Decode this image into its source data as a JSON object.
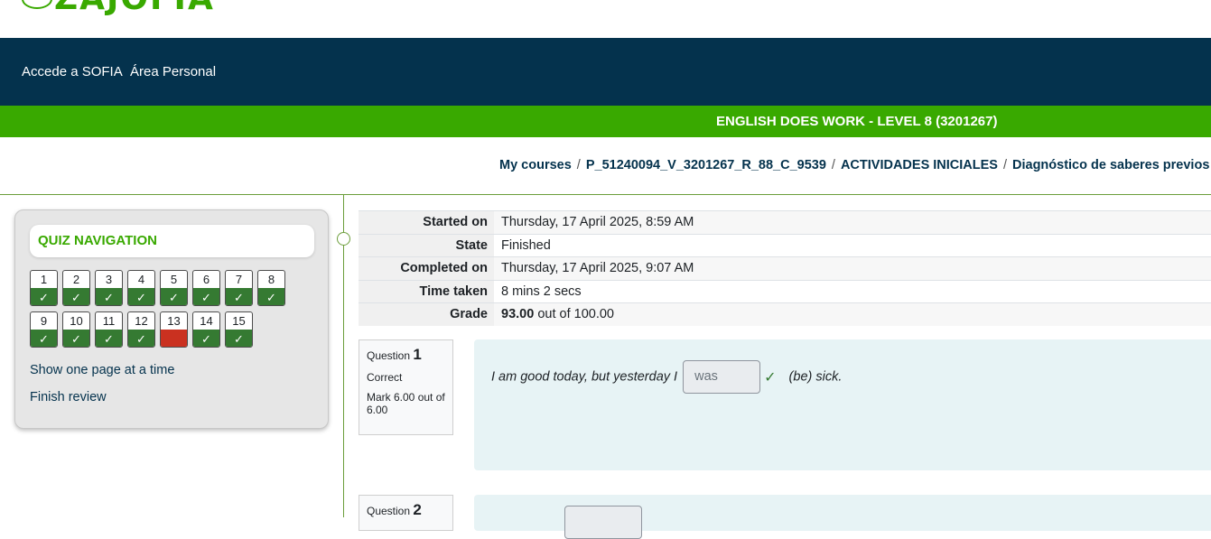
{
  "logo": {
    "text": "ZAJOFIA"
  },
  "navbar": {
    "items": [
      "Accede a SOFIA",
      "Área Personal"
    ]
  },
  "course": {
    "title": "ENGLISH DOES WORK - LEVEL 8 (3201267)"
  },
  "breadcrumb": [
    "My courses",
    "P_51240094_V_3201267_R_88_C_9539",
    "ACTIVIDADES INICIALES",
    "Diagnóstico de saberes previos"
  ],
  "quiz_nav": {
    "title": "QUIZ NAVIGATION",
    "questions": [
      {
        "n": "1",
        "status": "correct"
      },
      {
        "n": "2",
        "status": "correct"
      },
      {
        "n": "3",
        "status": "correct"
      },
      {
        "n": "4",
        "status": "correct"
      },
      {
        "n": "5",
        "status": "correct"
      },
      {
        "n": "6",
        "status": "correct"
      },
      {
        "n": "7",
        "status": "correct"
      },
      {
        "n": "8",
        "status": "correct"
      },
      {
        "n": "9",
        "status": "correct"
      },
      {
        "n": "10",
        "status": "correct"
      },
      {
        "n": "11",
        "status": "correct"
      },
      {
        "n": "12",
        "status": "correct"
      },
      {
        "n": "13",
        "status": "incorrect"
      },
      {
        "n": "14",
        "status": "correct"
      },
      {
        "n": "15",
        "status": "correct"
      }
    ],
    "show_one_page": "Show one page at a time",
    "finish_review": "Finish review"
  },
  "summary": {
    "started_label": "Started on",
    "started_value": "Thursday, 17 April 2025, 8:59 AM",
    "state_label": "State",
    "state_value": "Finished",
    "completed_label": "Completed on",
    "completed_value": "Thursday, 17 April 2025, 9:07 AM",
    "time_label": "Time taken",
    "time_value": "8 mins 2 secs",
    "grade_label": "Grade",
    "grade_value": "93.00",
    "grade_suffix": " out of 100.00"
  },
  "questions": [
    {
      "label": "Question",
      "number": "1",
      "state": "Correct",
      "mark": "Mark 6.00 out of 6.00",
      "text_before": "I am good today, but yesterday I",
      "answer": "was",
      "text_after": "(be) sick."
    },
    {
      "label": "Question",
      "number": "2"
    }
  ],
  "colors": {
    "navbar": "#04324d",
    "brand_green": "#39a900",
    "correct": "#357a32",
    "incorrect": "#ca3120",
    "question_bg": "#e7f3f5"
  }
}
